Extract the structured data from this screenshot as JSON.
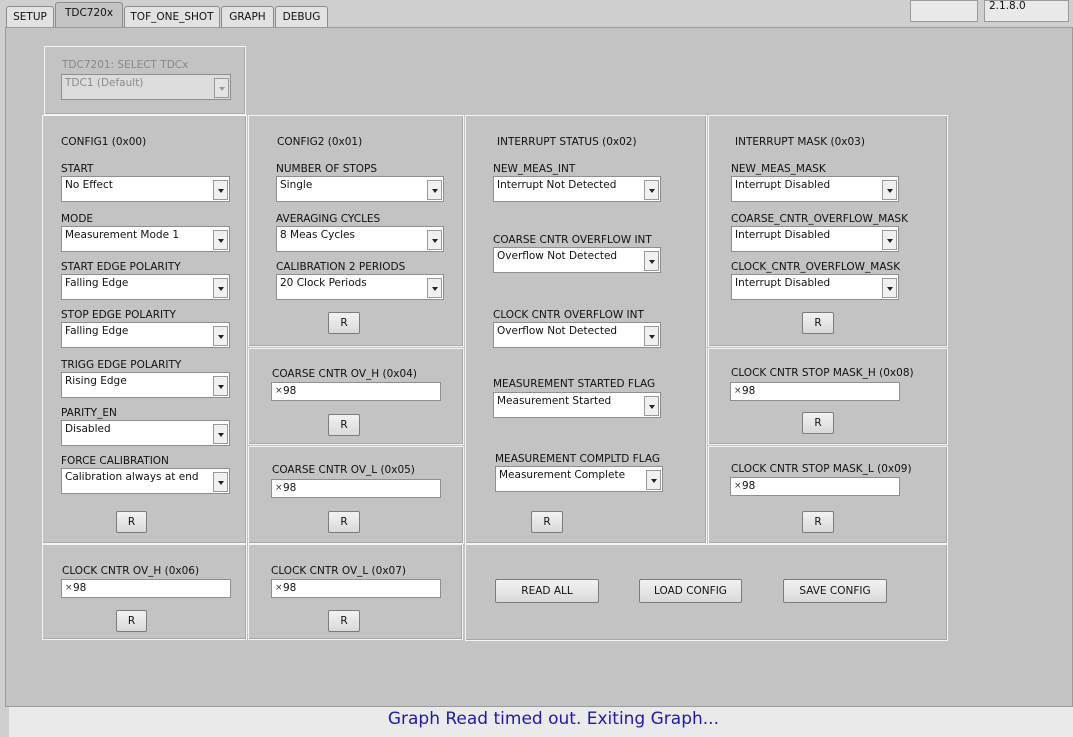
{
  "tabs": [
    "SETUP",
    "TDC720x",
    "TOF_ONE_SHOT",
    "GRAPH",
    "DEBUG"
  ],
  "version": "2.1.8.0",
  "select": {
    "title": "TDC7201: SELECT TDCx",
    "value": "TDC1 (Default)"
  },
  "config1": {
    "title": "CONFIG1 (0x00)",
    "start": {
      "label": "START",
      "value": "No Effect"
    },
    "mode": {
      "label": "MODE",
      "value": "Measurement Mode 1"
    },
    "sep": {
      "label": "START EDGE POLARITY",
      "value": "Falling Edge"
    },
    "stp": {
      "label": "STOP EDGE POLARITY",
      "value": "Falling Edge"
    },
    "trg": {
      "label": "TRIGG EDGE POLARITY",
      "value": "Rising Edge"
    },
    "par": {
      "label": "PARITY_EN",
      "value": "Disabled"
    },
    "fc": {
      "label": "FORCE CALIBRATION",
      "value": "Calibration always at end"
    }
  },
  "config2": {
    "title": "CONFIG2 (0x01)",
    "stops": {
      "label": "NUMBER OF STOPS",
      "value": "Single"
    },
    "avg": {
      "label": "AVERAGING CYCLES",
      "value": "8 Meas Cycles"
    },
    "cal": {
      "label": "CALIBRATION 2 PERIODS",
      "value": "20 Clock Periods"
    }
  },
  "intstat": {
    "title": "INTERRUPT STATUS (0x02)",
    "nm": {
      "label": "NEW_MEAS_INT",
      "value": "Interrupt Not Detected"
    },
    "co": {
      "label": "COARSE CNTR OVERFLOW INT",
      "value": "Overflow Not Detected"
    },
    "cl": {
      "label": "CLOCK CNTR OVERFLOW INT",
      "value": "Overflow Not Detected"
    },
    "ms": {
      "label": "MEASUREMENT STARTED FLAG",
      "value": "Measurement Started"
    },
    "mc": {
      "label": "MEASUREMENT COMPLTD FLAG",
      "value": "Measurement Complete"
    }
  },
  "intmask": {
    "title": "INTERRUPT MASK (0x03)",
    "nm": {
      "label": "NEW_MEAS_MASK",
      "value": "Interrupt Disabled"
    },
    "co": {
      "label": "COARSE_CNTR_OVERFLOW_MASK",
      "value": "Interrupt Disabled"
    },
    "cl": {
      "label": "CLOCK_CNTR_OVERFLOW_MASK",
      "value": "Interrupt Disabled"
    }
  },
  "regs": {
    "covh": {
      "label": "COARSE CNTR OV_H (0x04)",
      "value": "98"
    },
    "covl": {
      "label": "COARSE CNTR OV_L (0x05)",
      "value": "98"
    },
    "ccovh": {
      "label": "CLOCK CNTR OV_H (0x06)",
      "value": "98"
    },
    "ccovl": {
      "label": "CLOCK CNTR OV_L (0x07)",
      "value": "98"
    },
    "csmh": {
      "label": "CLOCK CNTR STOP MASK_H (0x08)",
      "value": "98"
    },
    "csml": {
      "label": "CLOCK CNTR STOP MASK_L (0x09)",
      "value": "98"
    }
  },
  "inc_symbol": "×",
  "r_label": "R",
  "actions": {
    "read_all": "READ ALL",
    "load": "LOAD CONFIG",
    "save": "SAVE CONFIG"
  },
  "status_msg": "Graph Read timed out. Exiting Graph..."
}
